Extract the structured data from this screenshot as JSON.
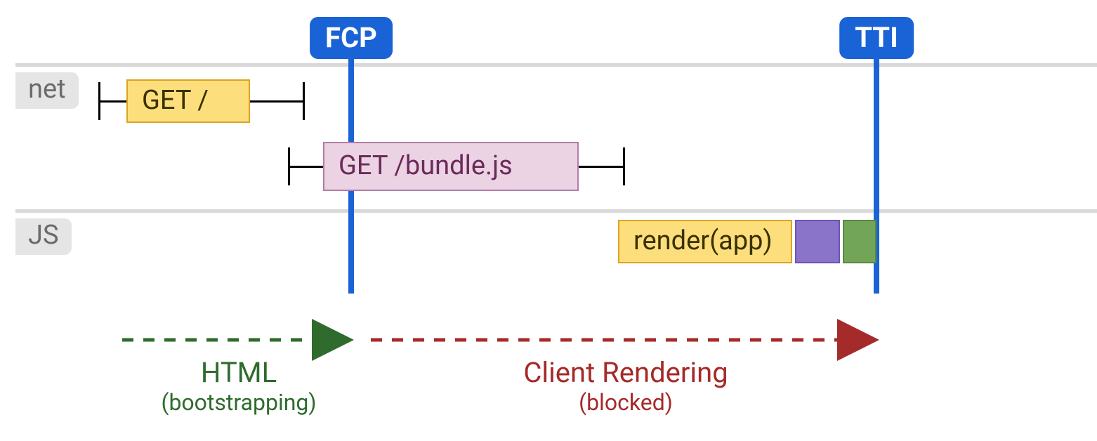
{
  "tracks": {
    "net": {
      "label": "net"
    },
    "js": {
      "label": "JS"
    }
  },
  "markers": {
    "fcp": {
      "label": "FCP"
    },
    "tti": {
      "label": "TTI"
    }
  },
  "net_requests": {
    "root": {
      "label": "GET /"
    },
    "bundle": {
      "label": "GET /bundle.js"
    }
  },
  "js_tasks": {
    "render": {
      "label": "render(app)"
    }
  },
  "phases": {
    "html": {
      "title": "HTML",
      "subtitle": "(bootstrapping)"
    },
    "client_rendering": {
      "title": "Client Rendering",
      "subtitle": "(blocked)"
    }
  },
  "colors": {
    "accent_blue": "#1a63d6",
    "yellow_fill": "#fcdf7c",
    "pink_fill": "#ebd3e4",
    "purple_fill": "#8974c9",
    "green_fill": "#72a558",
    "phase_green": "#2f6b2d",
    "phase_red": "#a52a2a"
  },
  "chart_data": {
    "type": "timeline",
    "lanes": [
      "net",
      "JS"
    ],
    "markers": [
      {
        "name": "FCP",
        "t": 500
      },
      {
        "name": "TTI",
        "t": 1248
      }
    ],
    "bars": [
      {
        "lane": "net",
        "label": "GET /",
        "t_start": 180,
        "t_end": 356,
        "whisker_start": 140,
        "whisker_end": 434
      },
      {
        "lane": "net",
        "label": "GET /bundle.js",
        "t_start": 460,
        "t_end": 824,
        "whisker_start": 410,
        "whisker_end": 890
      },
      {
        "lane": "JS",
        "label": "render(app)",
        "t_start": 880,
        "t_end": 1128
      },
      {
        "lane": "JS",
        "label": "(purple task)",
        "t_start": 1132,
        "t_end": 1196
      },
      {
        "lane": "JS",
        "label": "(green task)",
        "t_start": 1200,
        "t_end": 1248
      }
    ],
    "phases": [
      {
        "name": "HTML",
        "subtitle": "(bootstrapping)",
        "t_start": 174,
        "t_end": 500
      },
      {
        "name": "Client Rendering",
        "subtitle": "(blocked)",
        "t_start": 528,
        "t_end": 1248
      }
    ]
  }
}
